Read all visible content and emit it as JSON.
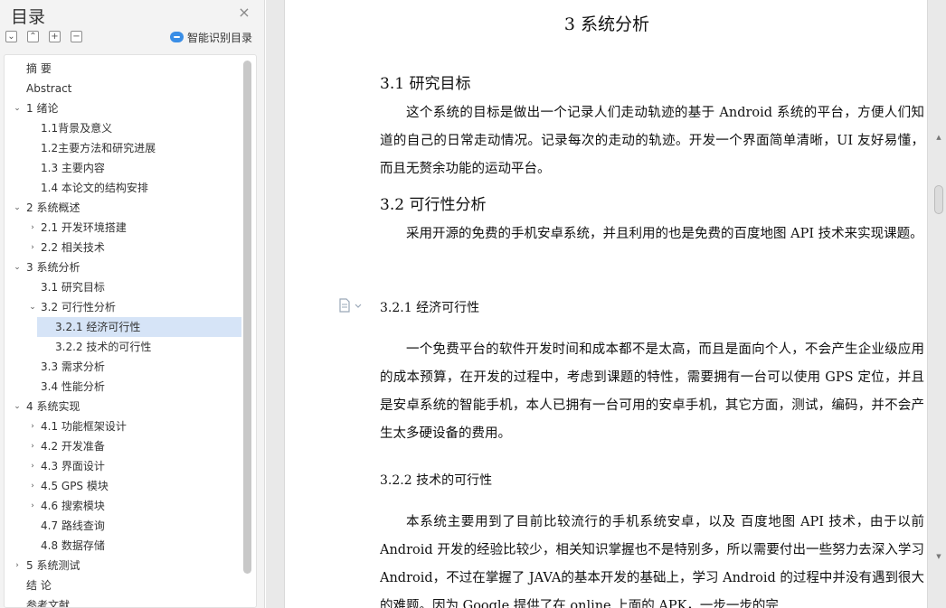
{
  "sidebar": {
    "title": "目录",
    "close_glyph": "×",
    "tools": {
      "collapse_glyph": "⌄",
      "expand_glyph": "⌃",
      "plus_glyph": "+",
      "minus_glyph": "−"
    },
    "smart_toc_label": "智能识别目录",
    "items": [
      {
        "label": "摘    要",
        "level": 1,
        "arrow": ""
      },
      {
        "label": "Abstract",
        "level": 1,
        "arrow": ""
      },
      {
        "label": "1 绪论",
        "level": 1,
        "arrow": "⌄"
      },
      {
        "label": "1.1背景及意义",
        "level": 2,
        "arrow": ""
      },
      {
        "label": "1.2主要方法和研究进展",
        "level": 2,
        "arrow": ""
      },
      {
        "label": "1.3 主要内容",
        "level": 2,
        "arrow": ""
      },
      {
        "label": "1.4 本论文的结构安排",
        "level": 2,
        "arrow": ""
      },
      {
        "label": "2 系统概述",
        "level": 1,
        "arrow": "⌄"
      },
      {
        "label": "2.1 开发环境搭建",
        "level": 2,
        "arrow": "›"
      },
      {
        "label": "2.2 相关技术",
        "level": 2,
        "arrow": "›"
      },
      {
        "label": "3 系统分析",
        "level": 1,
        "arrow": "⌄"
      },
      {
        "label": "3.1 研究目标",
        "level": 2,
        "arrow": ""
      },
      {
        "label": "3.2 可行性分析",
        "level": 2,
        "arrow": "⌄"
      },
      {
        "label": "3.2.1 经济可行性",
        "level": 3,
        "arrow": "",
        "selected": true
      },
      {
        "label": "3.2.2  技术的可行性",
        "level": 3,
        "arrow": ""
      },
      {
        "label": "3.3    需求分析",
        "level": 2,
        "arrow": ""
      },
      {
        "label": "3.4    性能分析",
        "level": 2,
        "arrow": ""
      },
      {
        "label": "4 系统实现",
        "level": 1,
        "arrow": "⌄"
      },
      {
        "label": "4.1 功能框架设计",
        "level": 2,
        "arrow": "›"
      },
      {
        "label": "4.2 开发准备",
        "level": 2,
        "arrow": "›"
      },
      {
        "label": "4.3 界面设计",
        "level": 2,
        "arrow": "›"
      },
      {
        "label": "4.5 GPS 模块",
        "level": 2,
        "arrow": "›"
      },
      {
        "label": "4.6 搜索模块",
        "level": 2,
        "arrow": "›"
      },
      {
        "label": "4.7 路线查询",
        "level": 2,
        "arrow": ""
      },
      {
        "label": "4.8 数据存储",
        "level": 2,
        "arrow": ""
      },
      {
        "label": "5 系统测试",
        "level": 1,
        "arrow": "›"
      },
      {
        "label": "结    论",
        "level": 1,
        "arrow": ""
      },
      {
        "label": "参考文献",
        "level": 1,
        "arrow": ""
      }
    ]
  },
  "document": {
    "chapter_title": "3 系统分析",
    "s31_title": "3.1 研究目标",
    "s31_body": "这个系统的目标是做出一个记录人们走动轨迹的基于 Android 系统的平台，方便人们知道的自己的日常走动情况。记录每次的走动的轨迹。开发一个界面简单清晰，UI 友好易懂，而且无赘余功能的运动平台。",
    "s32_title": "3.2 可行性分析",
    "s32_body": "采用开源的免费的手机安卓系统，并且利用的也是免费的百度地图 API 技术来实现课题。",
    "s321_title": "3.2.1 经济可行性",
    "s321_body": "一个免费平台的软件开发时间和成本都不是太高，而且是面向个人，不会产生企业级应用的成本预算，在开发的过程中，考虑到课题的特性，需要拥有一台可以使用 GPS 定位，并且是安卓系统的智能手机，本人已拥有一台可用的安卓手机，其它方面，测试，编码，并不会产生太多硬设备的费用。",
    "s322_title": "3.2.2  技术的可行性",
    "s322_body": "本系统主要用到了目前比较流行的手机系统安卓，以及 百度地图 API 技术，由于以前 Android 开发的经验比较少，相关知识掌握也不是特别多，所以需要付出一些努力去深入学习 Android，不过在掌握了 JAVA的基本开发的基础上，学习 Android 的过程中并没有遇到很大的难题。因为 Google 提供了在 online 上面的 APK，一步一步的完"
  },
  "colors": {
    "selected_bg": "#d6e4f7",
    "accent": "#3a8ee6"
  }
}
